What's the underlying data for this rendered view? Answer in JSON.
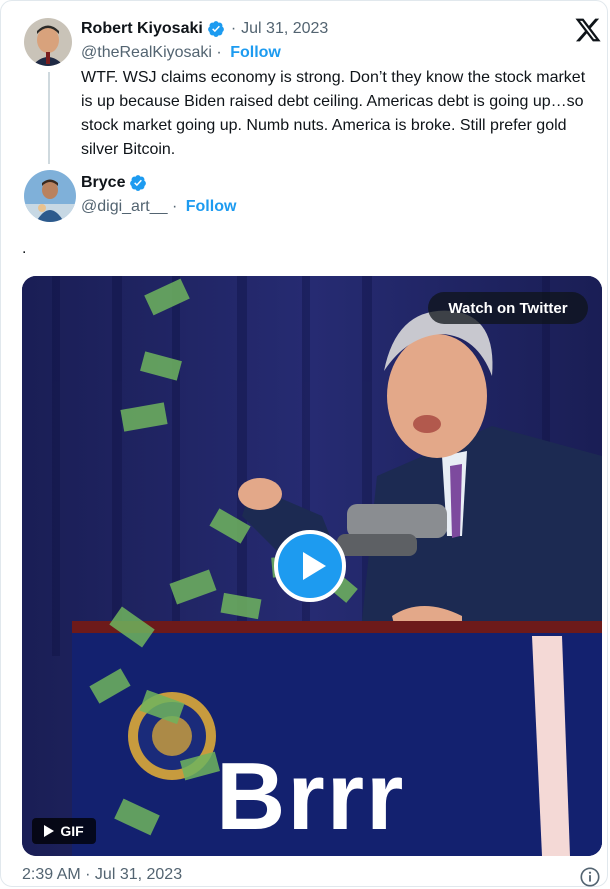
{
  "embed": {
    "brand_icon": "x-logo-icon",
    "main_tweet": {
      "author_name": "Robert Kiyosaki",
      "verified": true,
      "separator": "·",
      "date": "Jul 31, 2023",
      "handle": "@theRealKiyosaki",
      "handle_separator": "·",
      "follow_label": "Follow",
      "text": "WTF. WSJ claims economy is strong. Don’t they know the stock market is up because Biden raised debt ceiling. Americas debt is going up…so stock market going up. Numb nuts. America is broke. Still prefer gold silver Bitcoin."
    },
    "reply": {
      "author_name": "Bryce",
      "verified": true,
      "handle": "@digi_art__",
      "handle_separator": "·",
      "follow_label": "Follow",
      "text": "."
    },
    "media": {
      "watch_label": "Watch on Twitter",
      "overlay_text": "Brrr",
      "gif_label": "GIF",
      "play_icon": "play-icon"
    },
    "footer": {
      "timestamp": "2:39 AM · Jul 31, 2023",
      "info_icon": "info-icon"
    }
  },
  "colors": {
    "accent": "#1d9bf0",
    "muted": "#536471",
    "text": "#0f1419"
  }
}
